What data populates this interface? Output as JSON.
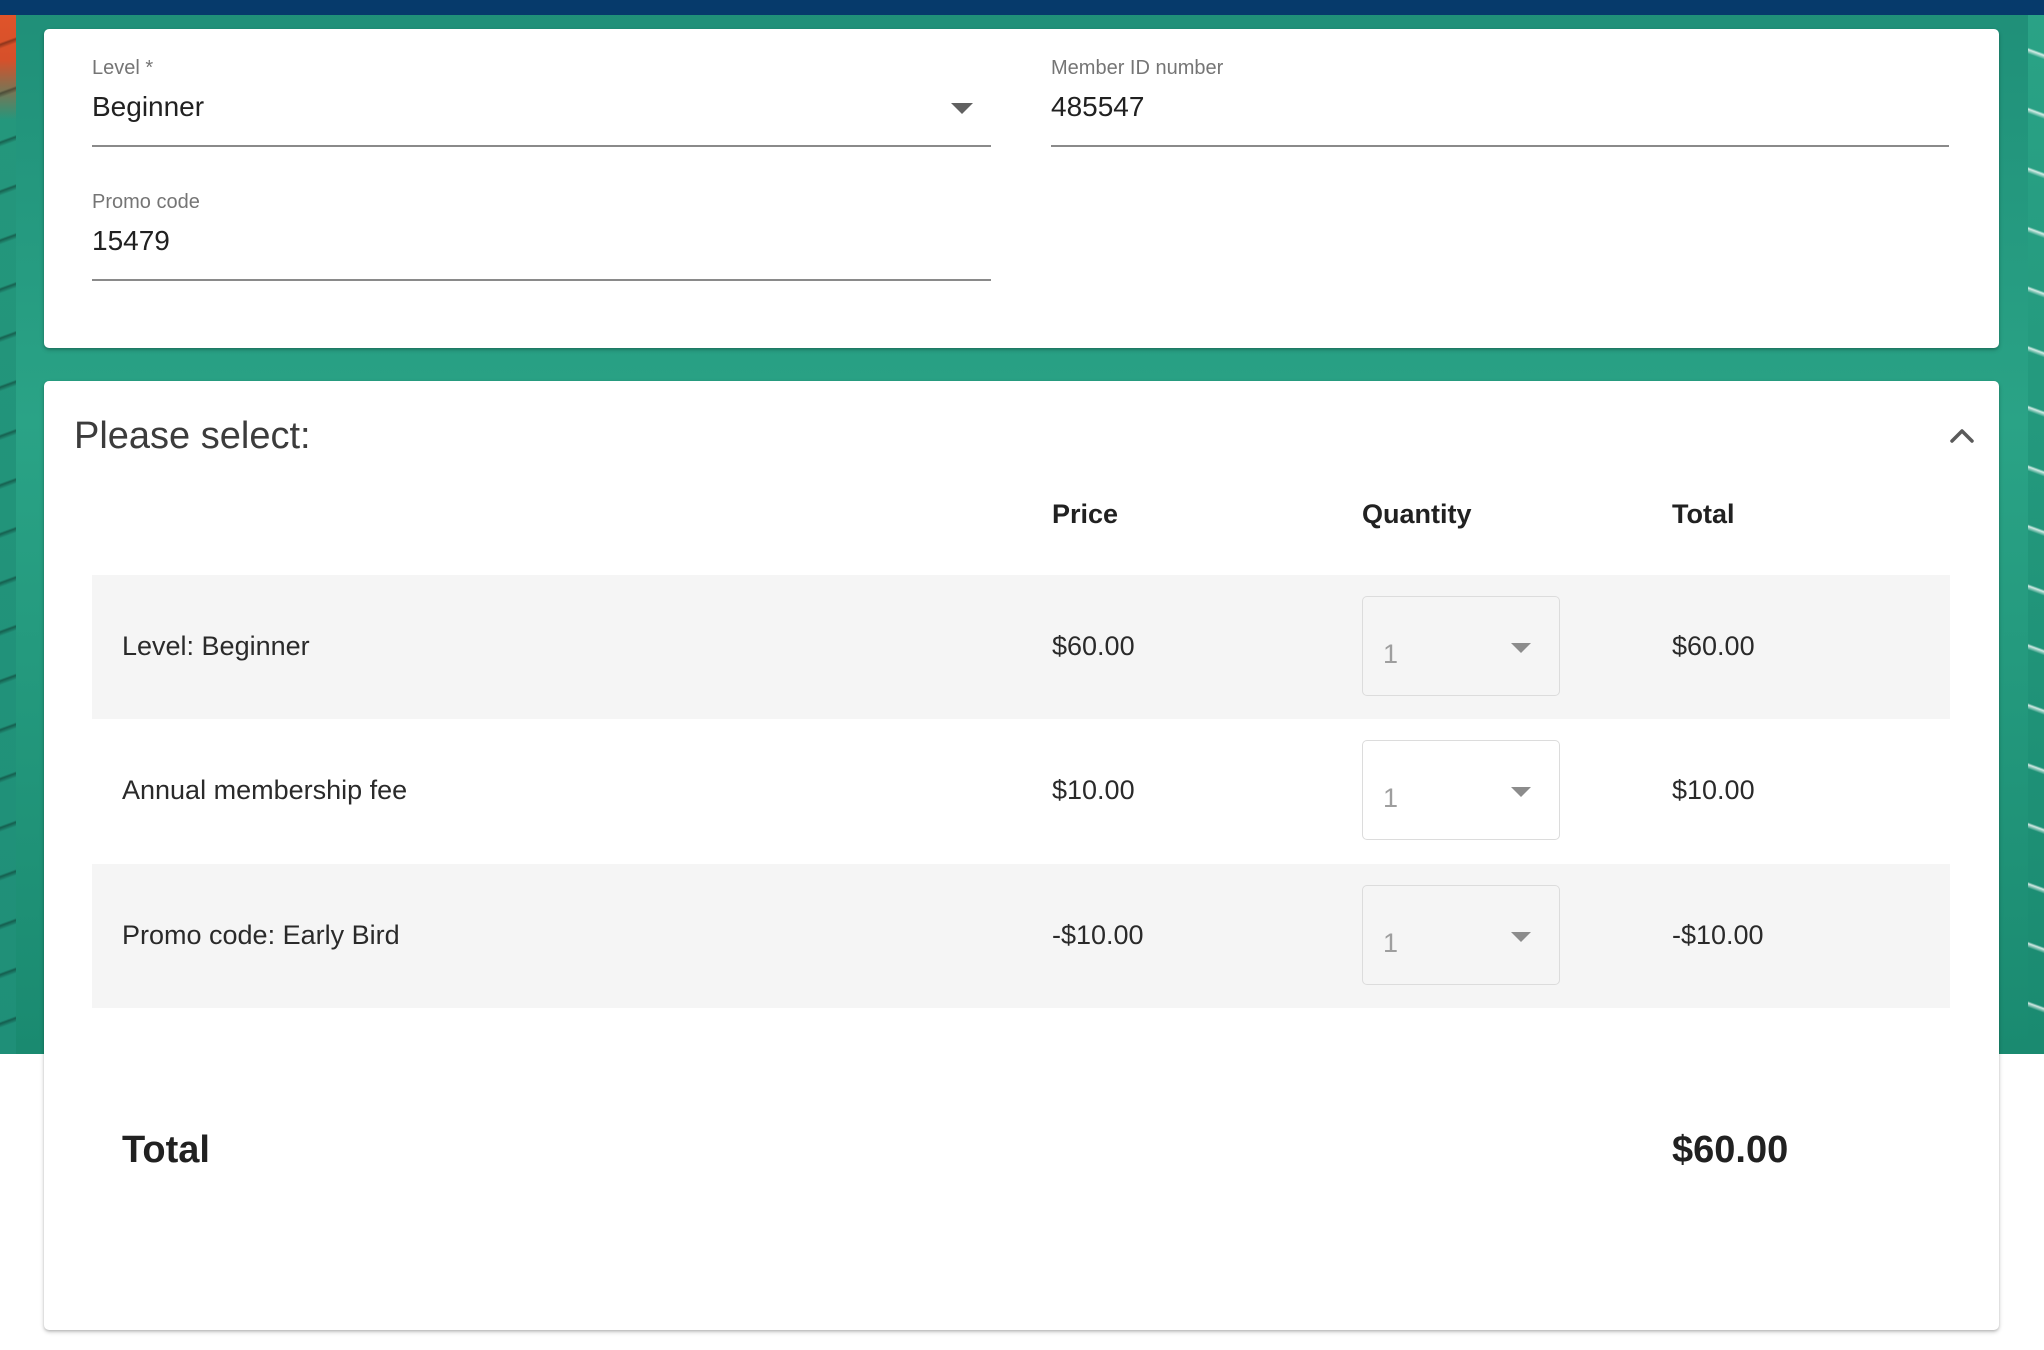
{
  "form": {
    "level": {
      "label": "Level *",
      "value": "Beginner"
    },
    "member_id": {
      "label": "Member ID number",
      "value": "485547"
    },
    "promo": {
      "label": "Promo code",
      "value": "15479"
    }
  },
  "selection": {
    "title": "Please select:",
    "headers": {
      "price": "Price",
      "quantity": "Quantity",
      "total": "Total"
    },
    "rows": [
      {
        "description": "Level: Beginner",
        "price": "$60.00",
        "quantity": "1",
        "total": "$60.00"
      },
      {
        "description": "Annual membership fee",
        "price": "$10.00",
        "quantity": "1",
        "total": "$10.00"
      },
      {
        "description": "Promo code: Early Bird",
        "price": "-$10.00",
        "quantity": "1",
        "total": "-$10.00"
      }
    ],
    "grand_total": {
      "label": "Total",
      "value": "$60.00"
    }
  },
  "colors": {
    "top_bar": "#063a6b",
    "background_art": "#1f8f78",
    "row_shade": "#f5f5f5"
  },
  "icons": {
    "collapse": "chevron-up-icon",
    "dropdown": "caret-down-icon"
  }
}
